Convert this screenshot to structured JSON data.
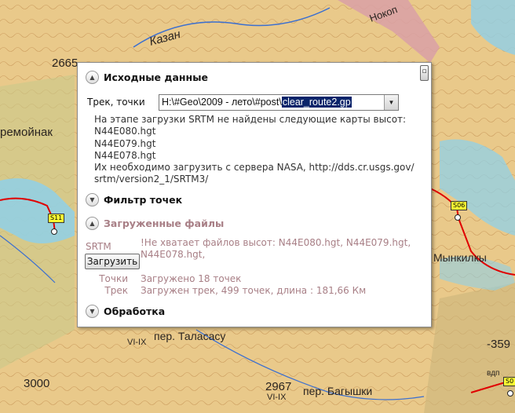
{
  "map": {
    "labels": [
      "Казан",
      "2665",
      "ремойнак",
      "Нокоп",
      "VI-IX",
      "Мынкилкы",
      "пер. Таласасу",
      "2967",
      "VI-IX",
      "пер. Багышки",
      "3000",
      "-359",
      "вдп"
    ],
    "waypoints": [
      "S11",
      "S06",
      "S0"
    ]
  },
  "panel": {
    "scroll_glyph": "▫",
    "section_source": {
      "title": "Исходные данные",
      "track_label": "Трек, точки",
      "combo_prefix": "H:\\#Geo\\2009 - лето\\#post\\",
      "combo_selected": "clear_route2.gp",
      "info_lines": [
        "На этапе загрузки SRTM не найдены следующие карты высот:",
        "N44E080.hgt",
        "N44E079.hgt",
        "N44E078.hgt",
        "Их необходимо загрузить с сервера NASA, http://dds.cr.usgs.gov/",
        "srtm/version2_1/SRTM3/"
      ]
    },
    "section_filter": {
      "title": "Фильтр точек"
    },
    "section_loaded": {
      "title": "Загруженные файлы",
      "srtm_label": "SRTM",
      "srtm_message": "!Не хватает файлов высот: N44E080.hgt, N44E079.hgt, N44E078.hgt,",
      "load_button": "Загрузить",
      "points_label": "Точки",
      "points_value": "Загружено 18 точек",
      "track_label": "Трек",
      "track_value": "Загружен трек, 499 точек, длина : 181,66 Км"
    },
    "section_processing": {
      "title": "Обработка"
    }
  },
  "colors": {
    "map_base": "#e9c98a",
    "muted_text": "#a87f86",
    "selection": "#0a246a",
    "route": "#e00000",
    "water": "#8fd0e8"
  }
}
